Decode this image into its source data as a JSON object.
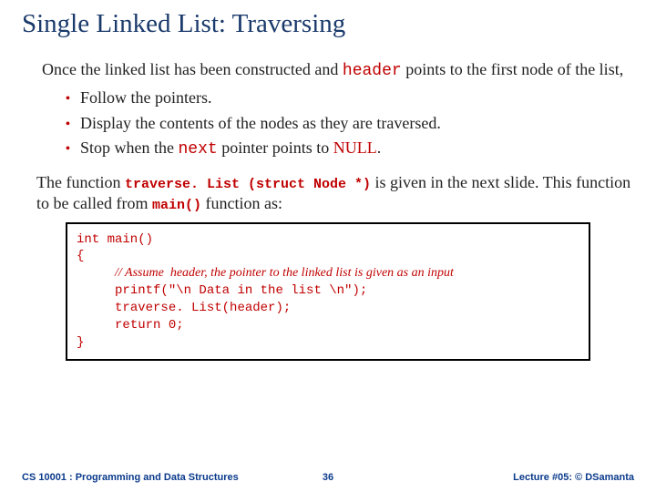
{
  "title": "Single Linked List: Traversing",
  "intro": {
    "pre": "Once the linked list has been constructed and ",
    "code": "header",
    "post": " points to the first node of the list,"
  },
  "bullets": [
    {
      "text": "Follow the pointers."
    },
    {
      "pre": "Display the contents of the nodes as they are traversed."
    },
    {
      "preText": "Stop when the ",
      "code": "next",
      "mid": " pointer points to ",
      "null": "NULL",
      "post": "."
    }
  ],
  "para2": {
    "pre": "The function ",
    "code1": "traverse. List (struct Node *)",
    "mid": " is given in the next slide. This function to be called from ",
    "code2": "main()",
    "post": " function as:"
  },
  "codebox": {
    "l1": "int main()",
    "l2": "{",
    "comment": "// Assume  header, the pointer to the linked list is given as an input",
    "l3": "printf(\"\\n Data in the list \\n\");",
    "l4": "traverse. List(header);",
    "l5": "return 0;",
    "l6": "}"
  },
  "footer": {
    "left": "CS 10001 : Programming and Data Structures",
    "center": "36",
    "right": "Lecture #05: © DSamanta"
  }
}
